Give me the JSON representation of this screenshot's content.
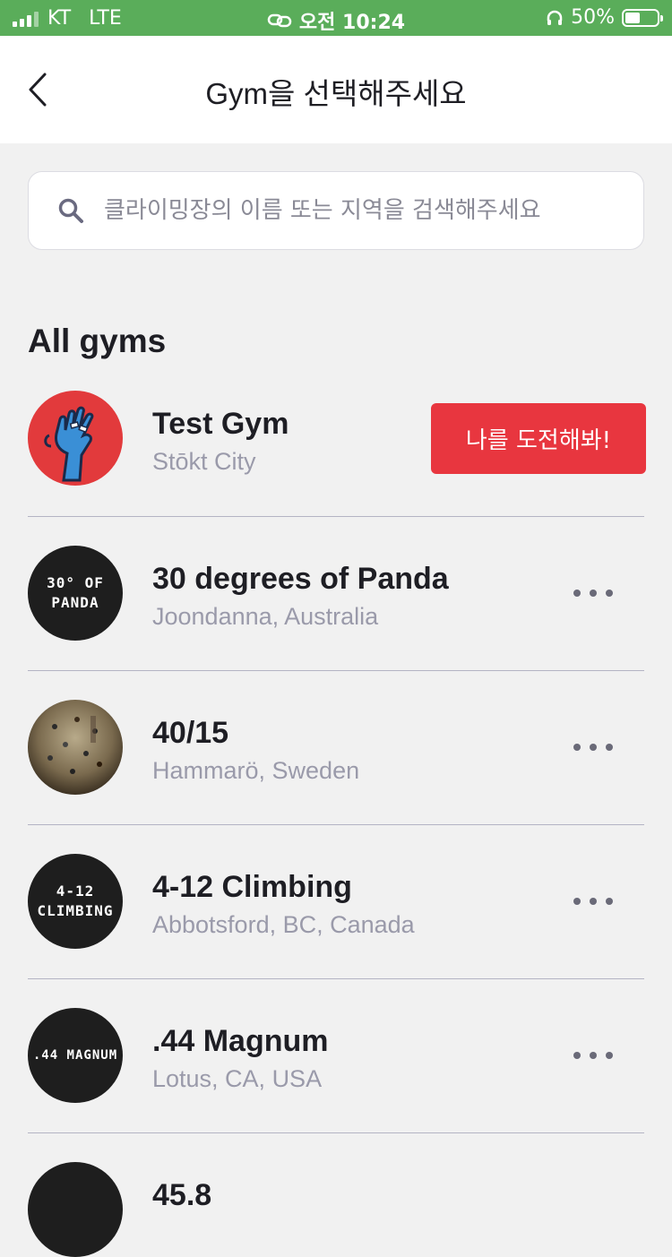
{
  "status_bar": {
    "carrier": "KT",
    "network": "LTE",
    "time": "오전 10:24",
    "battery_text": "50%",
    "battery_level": 0.5
  },
  "header": {
    "title": "Gym을 선택해주세요"
  },
  "search": {
    "placeholder": "클라이밍장의 이름 또는 지역을 검색해주세요",
    "value": ""
  },
  "section_title": "All gyms",
  "colors": {
    "status_bar": "#5aad5a",
    "accent_red": "#e8363f",
    "background": "#f1f1f1"
  },
  "gyms": [
    {
      "name": "Test Gym",
      "location": "Stōkt City",
      "avatar_text": "",
      "avatar_icon": "blue-hand-logo-icon",
      "action_label": "나를 도전해봐!"
    },
    {
      "name": "30 degrees of Panda",
      "location": "Joondanna, Australia",
      "avatar_line1": "30° OF",
      "avatar_line2": "PANDA"
    },
    {
      "name": "40/15",
      "location": "Hammarö, Sweden",
      "avatar_icon": "climbing-wall-photo-icon"
    },
    {
      "name": "4-12 Climbing",
      "location": "Abbotsford, BC, Canada",
      "avatar_line1": "4-12",
      "avatar_line2": "CLIMBING"
    },
    {
      "name": ".44 Magnum",
      "location": "Lotus, CA, USA",
      "avatar_line1": ".44 MAGNUM",
      "avatar_line2": ""
    },
    {
      "name": "45.8",
      "location": "",
      "avatar_line1": "",
      "avatar_line2": ""
    }
  ]
}
